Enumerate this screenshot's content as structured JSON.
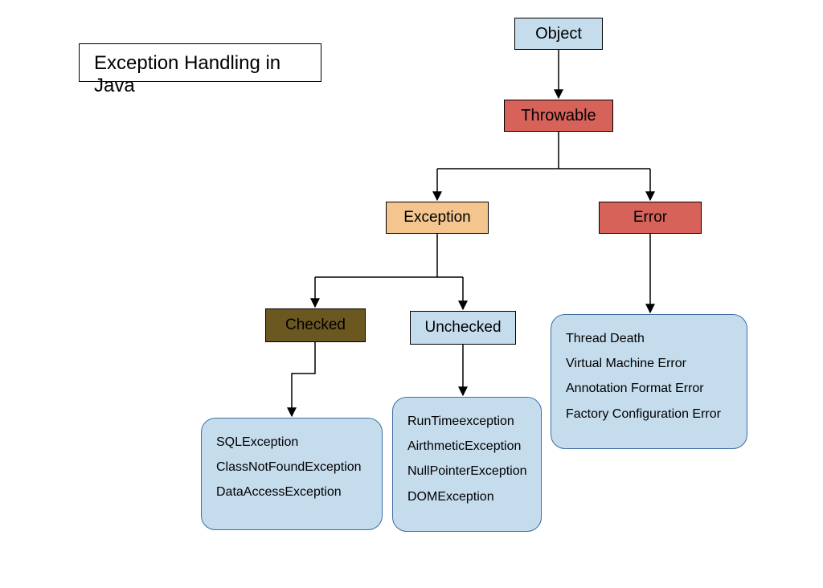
{
  "title": "Exception Handling in Java",
  "nodes": {
    "object": {
      "label": "Object"
    },
    "throwable": {
      "label": "Throwable"
    },
    "exception": {
      "label": "Exception"
    },
    "error": {
      "label": "Error"
    },
    "checked": {
      "label": "Checked"
    },
    "unchecked": {
      "label": "Unchecked"
    }
  },
  "lists": {
    "checked_items": [
      "SQLException",
      "ClassNotFoundException",
      "DataAccessException"
    ],
    "unchecked_items": [
      "RunTimeexception",
      "AirthmeticException",
      "NullPointerException",
      "DOMException"
    ],
    "error_items": [
      "Thread Death",
      "Virtual Machine Error",
      "Annotation Format Error",
      "Factory Configuration Error"
    ]
  },
  "chart_data": {
    "type": "hierarchy",
    "title": "Exception Handling in Java",
    "root": "Object",
    "edges": [
      [
        "Object",
        "Throwable"
      ],
      [
        "Throwable",
        "Exception"
      ],
      [
        "Throwable",
        "Error"
      ],
      [
        "Exception",
        "Checked"
      ],
      [
        "Exception",
        "Unchecked"
      ]
    ],
    "leaf_examples": {
      "Checked": [
        "SQLException",
        "ClassNotFoundException",
        "DataAccessException"
      ],
      "Unchecked": [
        "RunTimeexception",
        "AirthmeticException",
        "NullPointerException",
        "DOMException"
      ],
      "Error": [
        "Thread Death",
        "Virtual Machine Error",
        "Annotation Format Error",
        "Factory Configuration Error"
      ]
    }
  }
}
